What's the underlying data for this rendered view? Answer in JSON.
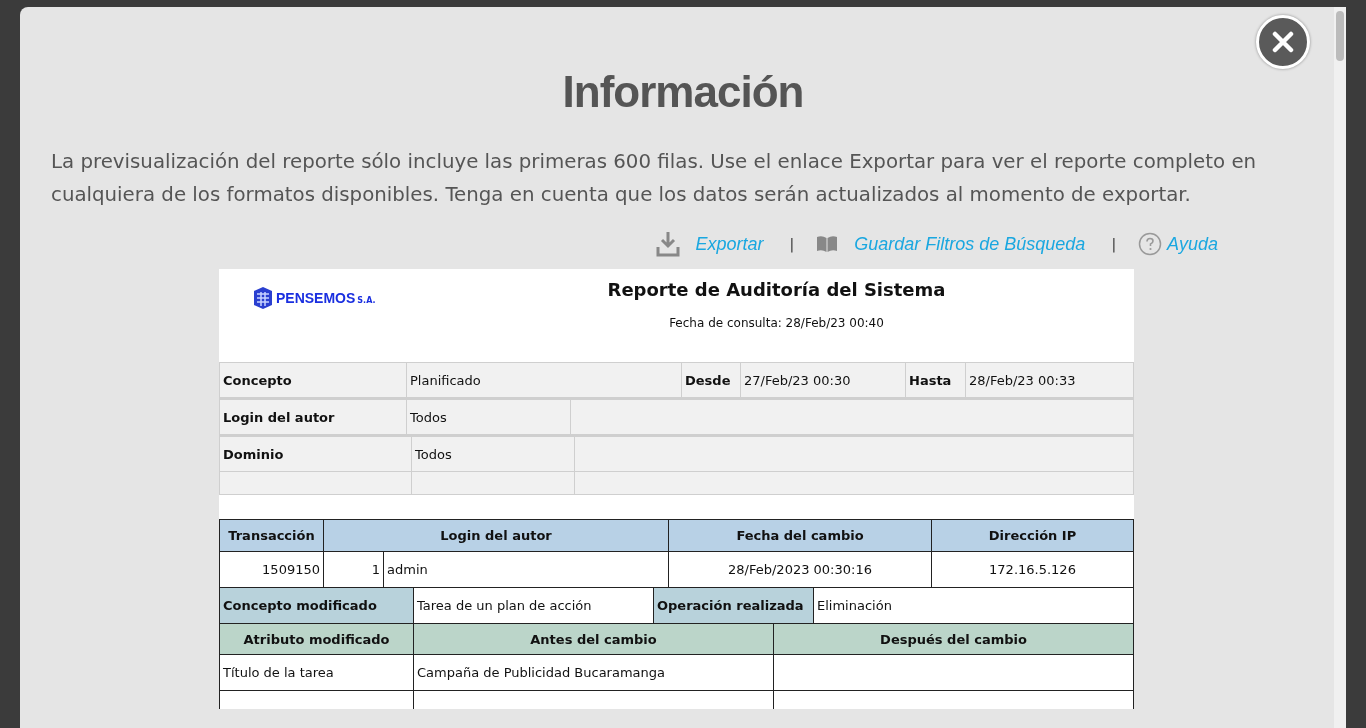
{
  "modal": {
    "title": "Información",
    "message": "La previsualización del reporte sólo incluye las primeras 600 filas. Use el enlace Exportar para ver el reporte completo en cualquiera de los formatos disponibles. Tenga en cuenta que los datos serán actualizados al momento de exportar.",
    "actions": [
      {
        "kind": "export",
        "label": "Exportar"
      },
      {
        "kind": "save",
        "label": "Guardar Filtros de Búsqueda"
      },
      {
        "kind": "help",
        "label": "Ayuda"
      }
    ],
    "separator": "|"
  },
  "report": {
    "logo": {
      "name": "PENSEMOS",
      "suffix": "S.A."
    },
    "title": "Reporte de Auditoría del Sistema",
    "query_date": "Fecha de consulta: 28/Feb/23 00:40",
    "filters": {
      "concepto_label": "Concepto",
      "concepto": "Planificado",
      "desde_label": "Desde",
      "desde": "27/Feb/23 00:30",
      "hasta_label": "Hasta",
      "hasta": "28/Feb/23 00:33",
      "login_label": "Login del autor",
      "login": "Todos",
      "dominio_label": "Dominio",
      "dominio": "Todos"
    },
    "transaction": {
      "columns": [
        "Transacción",
        "Login del autor",
        "Fecha del cambio",
        "Dirección IP"
      ],
      "row": {
        "id": "1509150",
        "user_id": "1",
        "login": "admin",
        "date": "28/Feb/2023 00:30:16",
        "ip": "172.16.5.126"
      },
      "concept_label": "Concepto modificado",
      "concept": "Tarea de un plan de acción",
      "operation_label": "Operación realizada",
      "operation": "Eliminación",
      "change_columns": [
        "Atributo modificado",
        "Antes del cambio",
        "Después del cambio"
      ],
      "changes": [
        {
          "attribute": "Título de la tarea",
          "before": "Campaña de Publicidad Bucaramanga"
        }
      ]
    }
  }
}
